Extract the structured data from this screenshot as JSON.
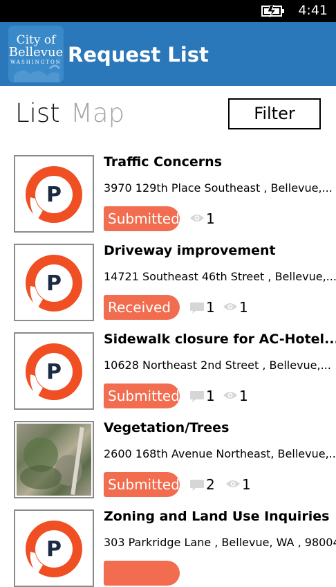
{
  "status_bar": {
    "time": "4:41",
    "battery_icon": "battery-charging-icon"
  },
  "header": {
    "title": "Request List",
    "logo_city": "City of",
    "logo_name": "Bellevue",
    "logo_state": "WASHINGTON"
  },
  "tabs": [
    {
      "label": "List",
      "active": true
    },
    {
      "label": "Map",
      "active": false
    }
  ],
  "filter_label": "Filter",
  "colors": {
    "header": "#2a77ba",
    "status_badge": "#f26d4f",
    "inactive_tab": "#a4a4a4"
  },
  "requests": [
    {
      "title": "Traffic Concerns",
      "address": "3970 129th Place Southeast , Bellevue,...",
      "status": "Submitted",
      "views": "1",
      "thumbnail": "logo"
    },
    {
      "title": "Driveway improvement",
      "address": "14721 Southeast 46th Street , Bellevue,...",
      "status": "Received",
      "comments": "1",
      "views": "1",
      "thumbnail": "logo"
    },
    {
      "title": "Sidewalk closure for AC-Hotel...",
      "address": "10628 Northeast 2nd Street , Bellevue,...",
      "status": "Submitted",
      "comments": "1",
      "views": "1",
      "thumbnail": "logo"
    },
    {
      "title": "Vegetation/Trees",
      "address": "2600 168th Avenue Northeast, Bellevue,...",
      "status": "Submitted",
      "comments": "2",
      "views": "1",
      "thumbnail": "photo"
    },
    {
      "title": "Zoning and Land Use Inquiries",
      "address": "303 Parkridge Lane , Bellevue, WA , 98004",
      "status": "",
      "thumbnail": "logo"
    }
  ]
}
